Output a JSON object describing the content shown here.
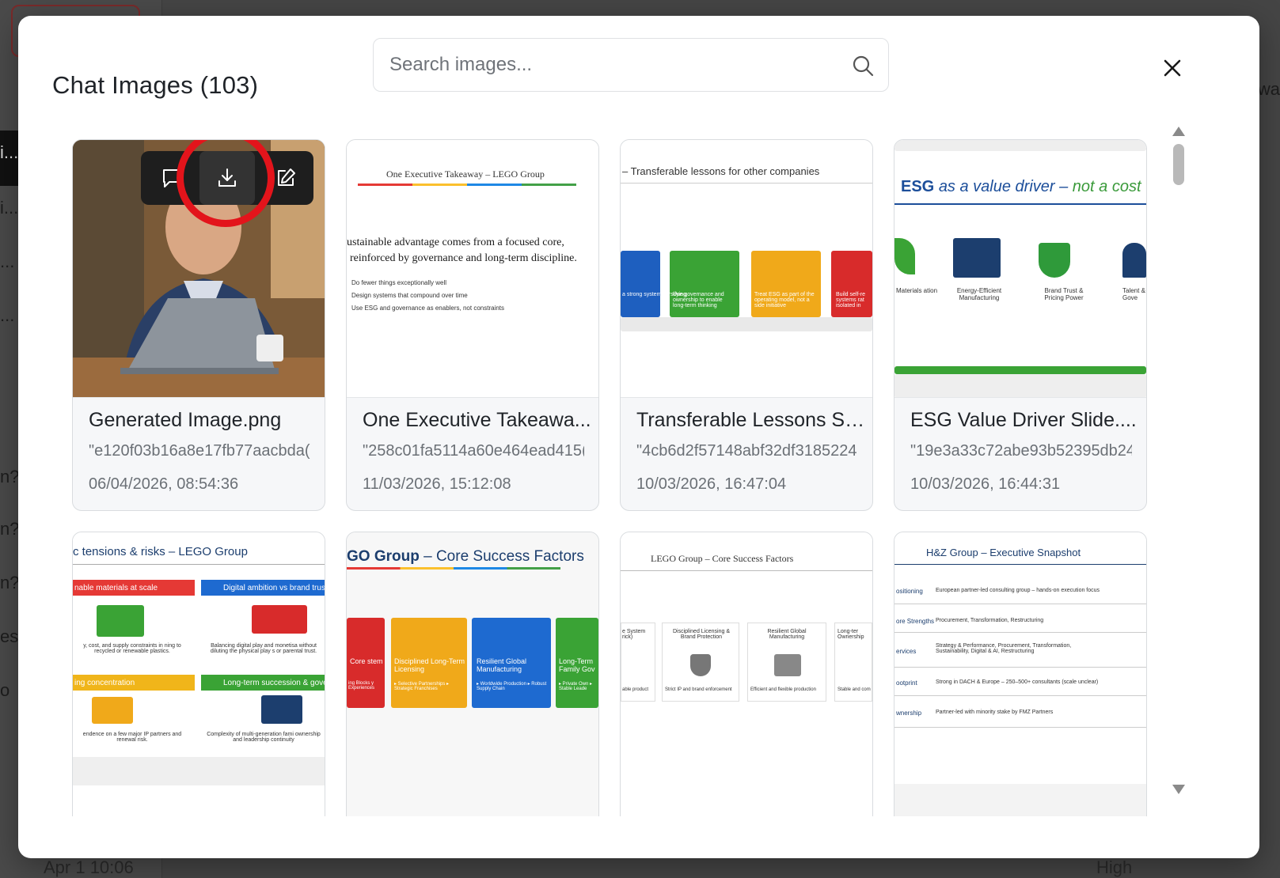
{
  "background": {
    "sidebar_labels": [
      "i...",
      "i...",
      "...",
      "...",
      "n?",
      "n?",
      "n?",
      "es",
      "o"
    ],
    "right_text": "wa",
    "bottom_left_text": "Apr 1 10:06",
    "bottom_right_text": "High"
  },
  "modal": {
    "title": "Chat Images (103)",
    "search_placeholder": "Search images...",
    "icons": {
      "search": "search-icon",
      "close": "close-icon",
      "chat": "chat-bubble-icon",
      "download": "download-icon",
      "edit": "edit-icon"
    },
    "highlight_color": "#e3141b"
  },
  "cards": [
    {
      "name": "Generated Image.png",
      "hash": "\"e120f03b16a8e17fb77aacbda(",
      "date": "06/04/2026, 08:54:36"
    },
    {
      "name": "One Executive Takeawa...",
      "hash": "\"258c01fa5114a60e464ead415(",
      "date": "11/03/2026, 15:12:08",
      "slide": {
        "title": "One Executive Takeaway – LEGO Group",
        "headline1": "ustainable advantage comes from a focused core,",
        "headline2": "reinforced by governance and long-term discipline.",
        "bullets": [
          "Do fewer things exceptionally well",
          "Design systems that compound over time",
          "Use ESG and governance as enablers, not constraints"
        ]
      }
    },
    {
      "name": "Transferable Lessons Sli...",
      "hash": "\"4cb6d2f57148abf32df3185224",
      "date": "10/03/2026, 16:47:04",
      "slide": {
        "title": "– Transferable lessons for other companies",
        "bricks": [
          "a strong system versifying",
          "Use governance and ownership to enable long-term thinking",
          "Treat ESG as part of the operating model, not a side initiative",
          "Build self-re systems rat isolated in"
        ]
      }
    },
    {
      "name": "ESG Value Driver Slide....",
      "hash": "\"19e3a33c72abe93b52395db24",
      "date": "10/03/2026, 16:44:31",
      "slide": {
        "title_a": "ESG",
        "title_b": "as a value driver –",
        "title_c": "not a cost",
        "items": [
          "Materials ation",
          "Energy-Efficient Manufacturing",
          "Brand Trust & Pricing Power",
          "Talent & Gove"
        ]
      }
    },
    {
      "slide": {
        "title": "c tensions & risks – LEGO Group",
        "headers": [
          "nable materials at scale",
          "Digital ambition vs brand trus",
          "ing concentration",
          "Long-term succession & govern"
        ],
        "texts": [
          "y, cost, and supply constraints in ning to recycled or renewable plastics.",
          "Balancing digital play and monetisa without diluting the physical play s or parental trust.",
          "endence on a few major IP partners and renewal risk.",
          "Complexity of multi-generation fami ownership and leadership continuity"
        ]
      }
    },
    {
      "slide": {
        "title_a": "GO Group",
        "title_b": " – Core Success Factors",
        "blocks": [
          "Core stem",
          "Disciplined Long-Term Licensing",
          "Resilient Global Manufacturing",
          "Long-Term Family Gov"
        ],
        "subs": [
          "ing Blocks y Experiences",
          "▸ Selective Partnerships ▸ Strategic Franchises",
          "▸ Worldwide Production ▸ Robust Supply Chain",
          "▸ Private Own ▸ Stable Leade"
        ]
      }
    },
    {
      "slide": {
        "title": "LEGO Group – Core Success Factors",
        "cols": [
          "e System rick)",
          "Disciplined Licensing & Brand Protection",
          "Resilient Global Manufacturing",
          "Long-ter Ownership"
        ],
        "foot": [
          "able product",
          "Strict IP and brand enforcement",
          "Efficient and flexible production",
          "Stable and com"
        ]
      }
    },
    {
      "slide": {
        "title": "H&Z Group – Executive Snapshot",
        "rows": [
          {
            "k": "ositioning",
            "v": "European partner-led consulting group – hands-on execution focus"
          },
          {
            "k": "ore Strengths",
            "v": "Procurement, Transformation, Restructuring"
          },
          {
            "k": "ervices",
            "v": "Strategy & Performance, Procurement, Transformation, Sustainability, Digital & AI, Restructuring"
          },
          {
            "k": "ootprint",
            "v": "Strong in DACH & Europe – 250–500+ consultants (scale unclear)"
          },
          {
            "k": "wnership",
            "v": "Partner-led with minority stake by FMZ Partners"
          }
        ]
      }
    }
  ]
}
